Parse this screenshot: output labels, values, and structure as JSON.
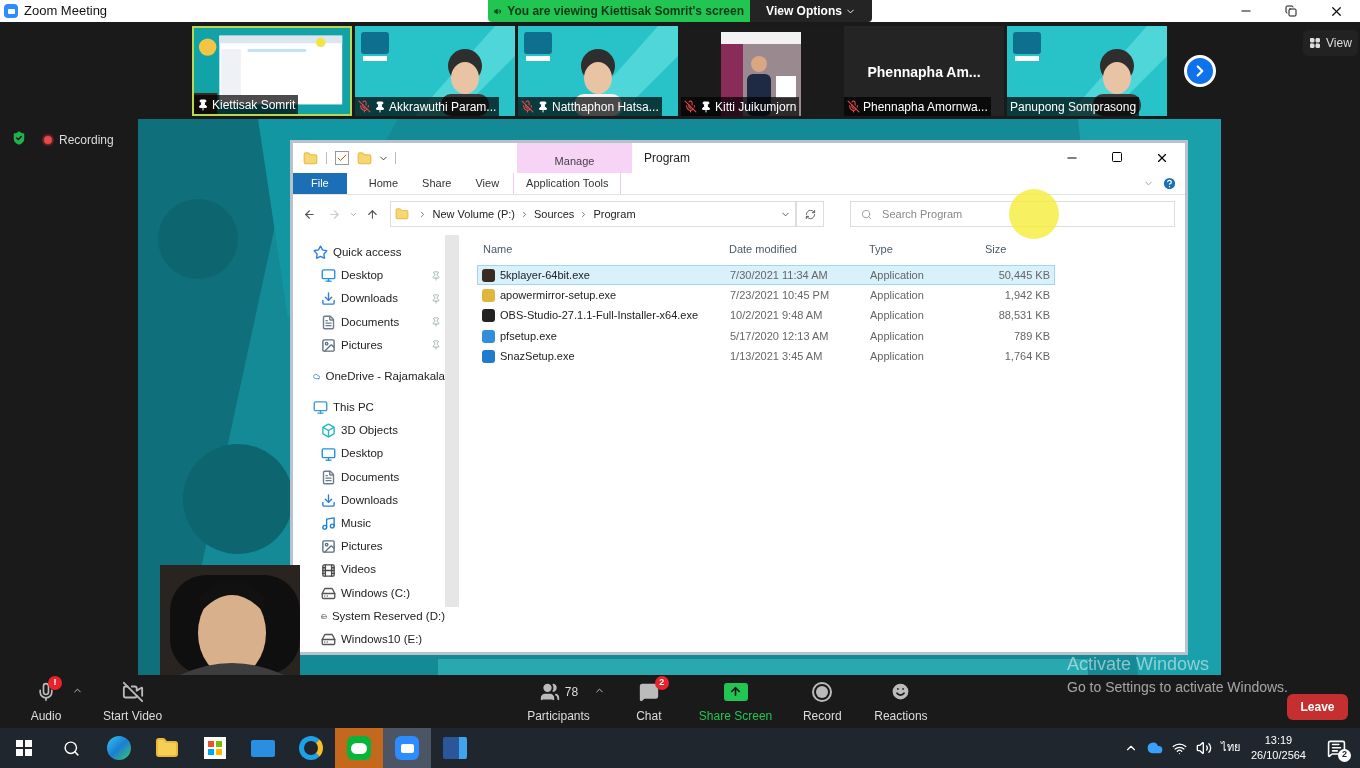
{
  "window": {
    "title": "Zoom Meeting"
  },
  "share_banner": {
    "text": "You are viewing Kiettisak Somrit's screen",
    "view_options": "View Options"
  },
  "participants_strip": [
    {
      "name": "Kiettisak Somrit",
      "muted": false,
      "pinned": true,
      "active_speaker": true,
      "kind": "screen"
    },
    {
      "name": "Akkrawuthi Param...",
      "muted": true,
      "pinned": true,
      "active_speaker": false,
      "kind": "video"
    },
    {
      "name": "Natthaphon Hatsa...",
      "muted": true,
      "pinned": true,
      "active_speaker": false,
      "kind": "video"
    },
    {
      "name": "Kitti Juikumjorn",
      "muted": true,
      "pinned": true,
      "active_speaker": false,
      "kind": "poster"
    },
    {
      "name": "Phennapha Amornwa...",
      "muted": true,
      "pinned": false,
      "active_speaker": false,
      "kind": "name",
      "display_name": "Phennapha  Am..."
    },
    {
      "name": "Panupong Somprasong",
      "muted": false,
      "pinned": false,
      "active_speaker": false,
      "kind": "video"
    }
  ],
  "view_button": "View",
  "recording": "Recording",
  "explorer": {
    "title": "Program",
    "context_tab": "Manage",
    "ribbon_tabs": [
      {
        "label": "File",
        "selected": true
      },
      {
        "label": "Home",
        "selected": false
      },
      {
        "label": "Share",
        "selected": false
      },
      {
        "label": "View",
        "selected": false
      },
      {
        "label": "Application Tools",
        "selected": false
      }
    ],
    "address": [
      "New Volume (P:)",
      "Sources",
      "Program"
    ],
    "search": {
      "placeholder": "Search Program"
    },
    "nav": [
      {
        "label": "Quick access",
        "kind": "star",
        "children": [
          {
            "label": "Desktop",
            "kind": "desktop",
            "pinned": true
          },
          {
            "label": "Downloads",
            "kind": "download",
            "pinned": true
          },
          {
            "label": "Documents",
            "kind": "document",
            "pinned": true
          },
          {
            "label": "Pictures",
            "kind": "pictures",
            "pinned": true
          }
        ]
      },
      {
        "label": "OneDrive - Rajamakala",
        "kind": "cloud"
      },
      {
        "label": "This PC",
        "kind": "pc",
        "children": [
          {
            "label": "3D Objects",
            "kind": "cube"
          },
          {
            "label": "Desktop",
            "kind": "desktop"
          },
          {
            "label": "Documents",
            "kind": "document"
          },
          {
            "label": "Downloads",
            "kind": "download"
          },
          {
            "label": "Music",
            "kind": "music"
          },
          {
            "label": "Pictures",
            "kind": "pictures"
          },
          {
            "label": "Videos",
            "kind": "video"
          },
          {
            "label": "Windows (C:)",
            "kind": "drive"
          },
          {
            "label": "System Reserved (D:)",
            "kind": "drive"
          },
          {
            "label": "Windows10 (E:)",
            "kind": "drive"
          }
        ]
      }
    ],
    "columns": [
      "Name",
      "Date modified",
      "Type",
      "Size"
    ],
    "rows": [
      {
        "name": "5kplayer-64bit.exe",
        "date": "7/30/2021 11:34 AM",
        "type": "Application",
        "size": "50,445 KB",
        "selected": true
      },
      {
        "name": "apowermirror-setup.exe",
        "date": "7/23/2021 10:45 PM",
        "type": "Application",
        "size": "1,942 KB",
        "selected": false
      },
      {
        "name": "OBS-Studio-27.1.1-Full-Installer-x64.exe",
        "date": "10/2/2021 9:48 AM",
        "type": "Application",
        "size": "88,531 KB",
        "selected": false
      },
      {
        "name": "pfsetup.exe",
        "date": "5/17/2020 12:13 AM",
        "type": "Application",
        "size": "789 KB",
        "selected": false
      },
      {
        "name": "SnazSetup.exe",
        "date": "1/13/2021 3:45 AM",
        "type": "Application",
        "size": "1,764 KB",
        "selected": false
      }
    ]
  },
  "activation": {
    "title": "Activate Windows",
    "subtitle": "Go to Settings to activate Windows."
  },
  "toolbar": [
    {
      "label": "Audio",
      "kind": "audio",
      "badge": "!",
      "caret": true
    },
    {
      "label": "Start Video",
      "kind": "video",
      "caret": false
    },
    {
      "label": "Participants",
      "kind": "participants",
      "count": "78",
      "caret": true
    },
    {
      "label": "Chat",
      "kind": "chat",
      "badge": "2",
      "caret": false
    },
    {
      "label": "Share Screen",
      "kind": "share",
      "caret": false
    },
    {
      "label": "Record",
      "kind": "record",
      "caret": false
    },
    {
      "label": "Reactions",
      "kind": "reactions",
      "caret": false
    }
  ],
  "leave": "Leave",
  "taskbar": {
    "apps": [
      {
        "kind": "edge",
        "selected": false
      },
      {
        "kind": "explorer",
        "selected": false
      },
      {
        "kind": "store",
        "selected": false
      },
      {
        "kind": "mail",
        "selected": false
      },
      {
        "kind": "ie",
        "selected": false
      },
      {
        "kind": "line",
        "selected": true
      },
      {
        "kind": "zoom",
        "selected": true
      },
      {
        "kind": "word",
        "selected": false
      }
    ],
    "language": "ไทย",
    "time": "13:19",
    "date": "26/10/2564",
    "notifications": "2"
  }
}
